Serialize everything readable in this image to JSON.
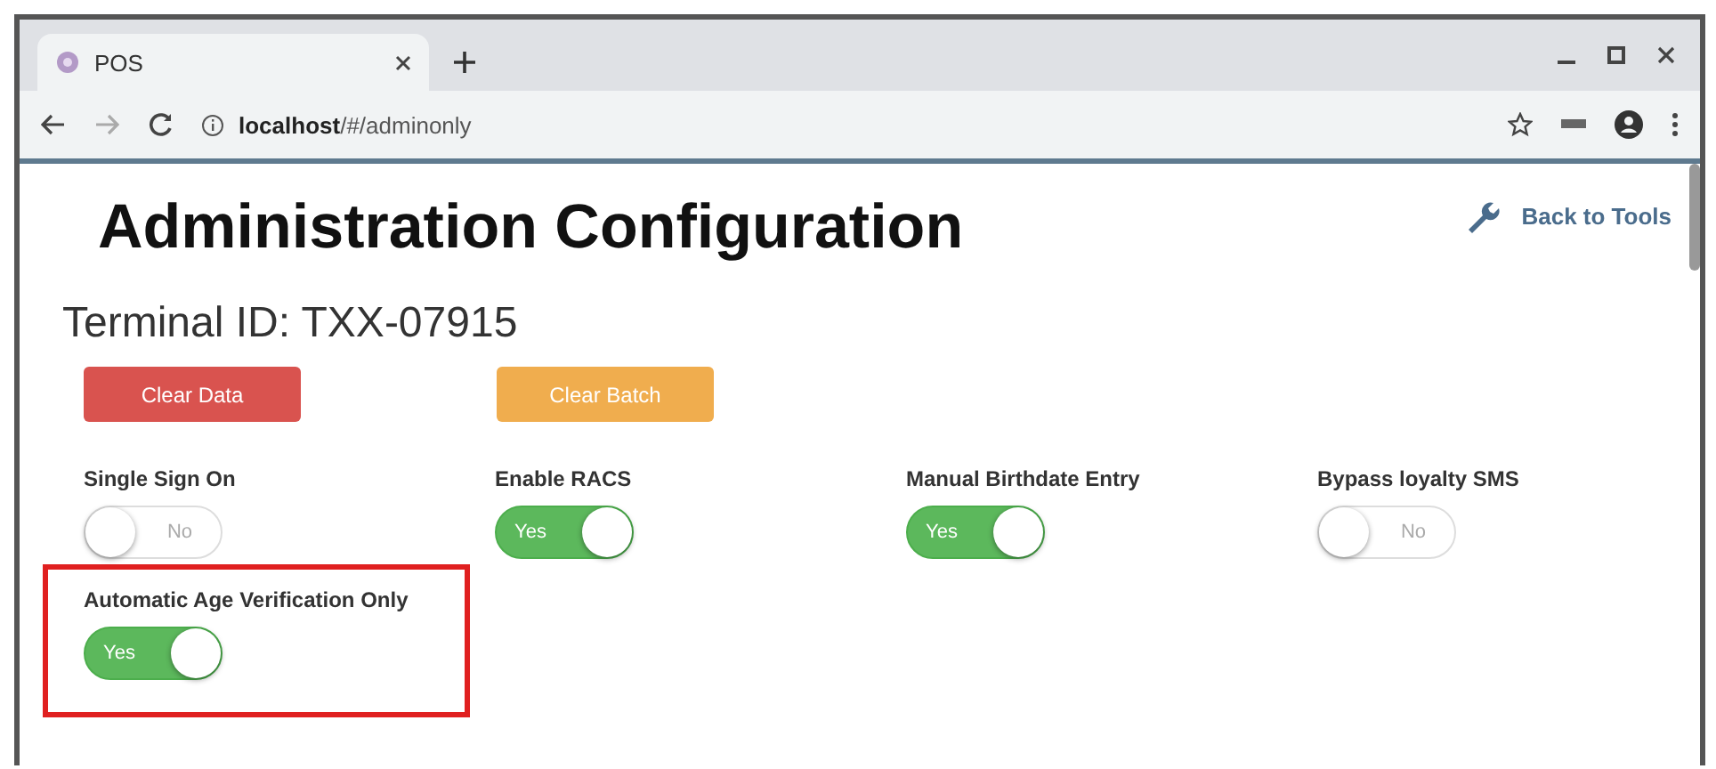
{
  "browser": {
    "tab_title": "POS",
    "url_host": "localhost",
    "url_path": "/#/adminonly"
  },
  "page": {
    "title": "Administration Configuration",
    "back_link": "Back to Tools",
    "terminal_id": "Terminal ID: TXX-07915",
    "buttons": [
      {
        "label": "Clear Data",
        "kind": "danger"
      },
      {
        "label": "Clear Batch",
        "kind": "warning"
      }
    ],
    "settings": [
      {
        "label": "Single Sign On",
        "on": false,
        "state_text": "No",
        "highlighted": false
      },
      {
        "label": "Enable RACS",
        "on": true,
        "state_text": "Yes",
        "highlighted": false
      },
      {
        "label": "Manual Birthdate Entry",
        "on": true,
        "state_text": "Yes",
        "highlighted": false
      },
      {
        "label": "Bypass loyalty SMS",
        "on": false,
        "state_text": "No",
        "highlighted": false
      },
      {
        "label": "Automatic Age Verification Only",
        "on": true,
        "state_text": "Yes",
        "highlighted": true
      }
    ]
  }
}
